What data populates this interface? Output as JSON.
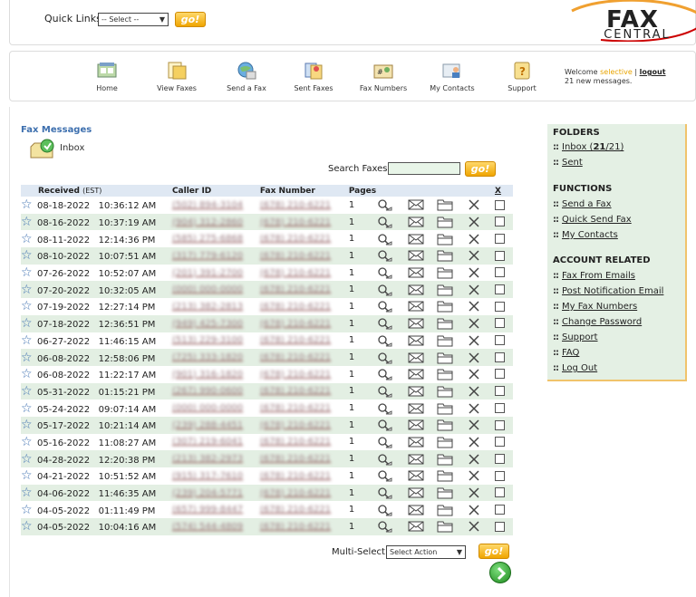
{
  "quick_links": {
    "label": "Quick Links:",
    "selected": "-- Select --",
    "go_label": "go!"
  },
  "logo": {
    "line1": "FAX",
    "line2": "CENTRAL"
  },
  "nav": [
    {
      "label": "Home",
      "icon": "home-icon"
    },
    {
      "label": "View Faxes",
      "icon": "view-faxes-icon"
    },
    {
      "label": "Send a Fax",
      "icon": "send-fax-icon"
    },
    {
      "label": "Sent Faxes",
      "icon": "sent-faxes-icon"
    },
    {
      "label": "Fax Numbers",
      "icon": "fax-numbers-icon"
    },
    {
      "label": "My Contacts",
      "icon": "my-contacts-icon"
    },
    {
      "label": "Support",
      "icon": "support-icon"
    }
  ],
  "welcome": {
    "prefix": "Welcome",
    "user": "selective",
    "separator": "|",
    "logout": "logout",
    "messages": "21 new messages."
  },
  "fax_messages": {
    "title": "Fax Messages",
    "inbox": "Inbox"
  },
  "search": {
    "label": "Search Faxes:",
    "value": "",
    "go_label": "go!"
  },
  "table": {
    "headers": {
      "received": "Received",
      "received_tz": "(EST)",
      "caller": "Caller ID",
      "fax": "Fax Number",
      "pages": "Pages",
      "x": "X"
    },
    "rows": [
      {
        "date": "08-18-2022",
        "time": "10:36:12 AM",
        "caller": "(502) 894-3104",
        "fax": "(678) 210-6221",
        "pages": "1"
      },
      {
        "date": "08-16-2022",
        "time": "10:37:19 AM",
        "caller": "(904) 312-2860",
        "fax": "(678) 210-6221",
        "pages": "1"
      },
      {
        "date": "08-11-2022",
        "time": "12:14:36 PM",
        "caller": "(585) 275-6868",
        "fax": "(678) 210-6221",
        "pages": "1"
      },
      {
        "date": "08-10-2022",
        "time": "10:07:51 AM",
        "caller": "(317) 779-6120",
        "fax": "(678) 210-6221",
        "pages": "1"
      },
      {
        "date": "07-26-2022",
        "time": "10:52:07 AM",
        "caller": "(201) 391-2700",
        "fax": "(678) 210-6221",
        "pages": "1"
      },
      {
        "date": "07-20-2022",
        "time": "10:32:05 AM",
        "caller": "(000) 000-0000",
        "fax": "(678) 210-6221",
        "pages": "1"
      },
      {
        "date": "07-19-2022",
        "time": "12:27:14 PM",
        "caller": "(213) 382-2813",
        "fax": "(678) 210-6221",
        "pages": "1"
      },
      {
        "date": "07-18-2022",
        "time": "12:36:51 PM",
        "caller": "(949) 425-7300",
        "fax": "(678) 210-6221",
        "pages": "1"
      },
      {
        "date": "06-27-2022",
        "time": "11:46:15 AM",
        "caller": "(513) 229-3100",
        "fax": "(678) 210-6221",
        "pages": "1"
      },
      {
        "date": "06-08-2022",
        "time": "12:58:06 PM",
        "caller": "(725) 333-1820",
        "fax": "(678) 210-6221",
        "pages": "1"
      },
      {
        "date": "06-08-2022",
        "time": "11:22:17 AM",
        "caller": "(901) 316-1820",
        "fax": "(678) 210-6221",
        "pages": "1"
      },
      {
        "date": "05-31-2022",
        "time": "01:15:21 PM",
        "caller": "(267) 990-0600",
        "fax": "(678) 210-6221",
        "pages": "1"
      },
      {
        "date": "05-24-2022",
        "time": "09:07:14 AM",
        "caller": "(000) 000-0000",
        "fax": "(678) 210-6221",
        "pages": "1"
      },
      {
        "date": "05-17-2022",
        "time": "10:21:14 AM",
        "caller": "(239) 288-4451",
        "fax": "(678) 210-6221",
        "pages": "1"
      },
      {
        "date": "05-16-2022",
        "time": "11:08:27 AM",
        "caller": "(307) 219-6041",
        "fax": "(678) 210-6221",
        "pages": "1"
      },
      {
        "date": "04-28-2022",
        "time": "12:20:38 PM",
        "caller": "(213) 382-2973",
        "fax": "(678) 210-6221",
        "pages": "1"
      },
      {
        "date": "04-21-2022",
        "time": "10:51:52 AM",
        "caller": "(915) 317-7610",
        "fax": "(678) 210-6221",
        "pages": "1"
      },
      {
        "date": "04-06-2022",
        "time": "11:46:35 AM",
        "caller": "(239) 204-5771",
        "fax": "(678) 210-6221",
        "pages": "1"
      },
      {
        "date": "04-05-2022",
        "time": "01:11:49 PM",
        "caller": "(657) 999-8447",
        "fax": "(678) 210-6221",
        "pages": "1"
      },
      {
        "date": "04-05-2022",
        "time": "10:04:16 AM",
        "caller": "(574) 544-4809",
        "fax": "(678) 210-6221",
        "pages": "1"
      }
    ]
  },
  "multi_select": {
    "label": "Multi-Select:",
    "selected": "Select Action",
    "go_label": "go!"
  },
  "sidebar": {
    "folders_title": "FOLDERS",
    "inbox_label": "Inbox (",
    "inbox_unread": "21",
    "inbox_total": "/21)",
    "sent": "Sent",
    "functions_title": "FUNCTIONS",
    "functions": [
      "Send a Fax",
      "Quick Send Fax",
      "My Contacts"
    ],
    "account_title": "ACCOUNT RELATED",
    "account": [
      "Fax From Emails",
      "Post Notification Email",
      "My Fax Numbers",
      "Change Password",
      "Support",
      "FAQ",
      "Log Out"
    ]
  },
  "colors": {
    "accent": "#3d6fae",
    "go": "#f0a500",
    "row_alt": "#e3efe3",
    "sidebar": "#e4f0e4"
  }
}
